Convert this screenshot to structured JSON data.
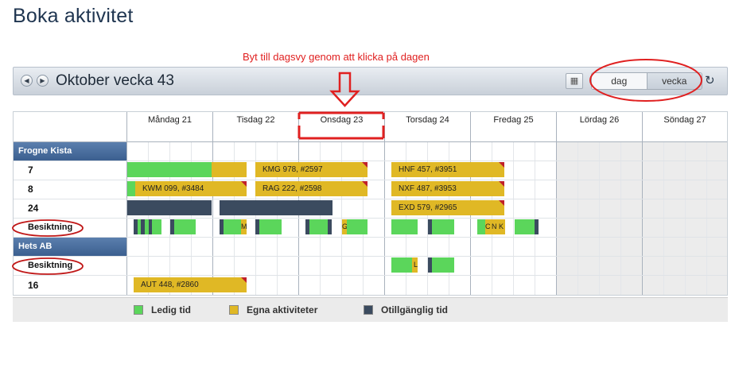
{
  "page": {
    "title": "Boka aktivitet"
  },
  "annotation": {
    "text": "Byt till dagsvy genom att klicka på dagen"
  },
  "toolbar": {
    "prev_icon": "◀",
    "next_icon": "▶",
    "week_title": "Oktober vecka 43",
    "view_day": "dag",
    "view_week": "vecka",
    "print_icon": "▦",
    "refresh_icon": "↻"
  },
  "days": [
    {
      "label": "Måndag 21"
    },
    {
      "label": "Tisdag 22"
    },
    {
      "label": "Onsdag 23"
    },
    {
      "label": "Torsdag 24"
    },
    {
      "label": "Fredag 25"
    },
    {
      "label": "Lördag 26"
    },
    {
      "label": "Söndag 27"
    }
  ],
  "groups": [
    {
      "name": "Frogne Kista",
      "rows": [
        "7",
        "8",
        "24",
        "Besiktning"
      ]
    },
    {
      "name": "Hets AB",
      "rows": [
        "Besiktning",
        "16"
      ]
    }
  ],
  "bookings": {
    "kmg": "KMG 978, #2597",
    "hnf": "HNF 457, #3951",
    "kwm": "KWM 099, #3484",
    "rag": "RAG 222, #2598",
    "nxf": "NXF 487, #3953",
    "exd": "EXD 579, #2965",
    "aut": "AUT 448, #2860",
    "m": "M",
    "g": "G",
    "c": "C",
    "n": "N",
    "k": "K",
    "l": "L"
  },
  "legend": {
    "free": "Ledig tid",
    "own": "Egna aktiviteter",
    "unavailable": "Otillgänglig tid"
  },
  "colors": {
    "free": "#5bd65b",
    "own": "#e0b825",
    "unavailable": "#3b4b5f",
    "accent": "#e02020"
  }
}
